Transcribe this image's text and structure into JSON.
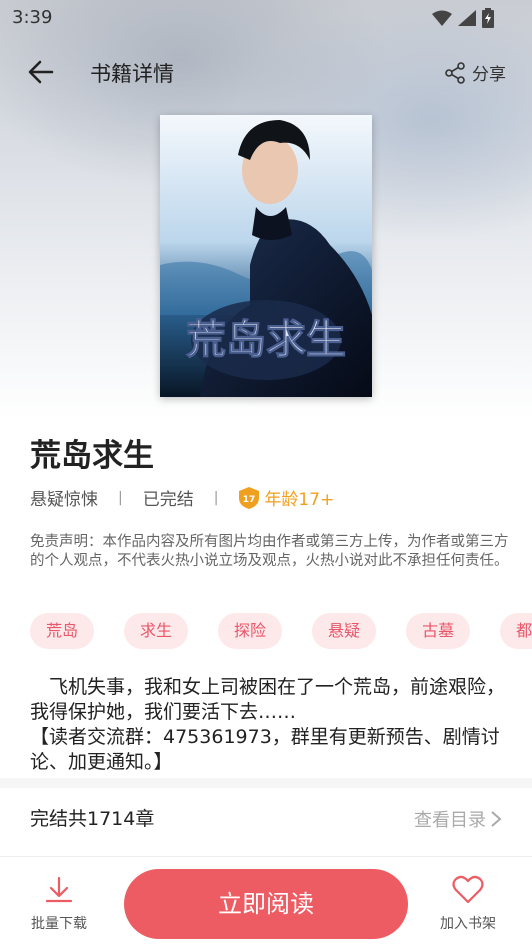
{
  "status_bar": {
    "time": "3:39"
  },
  "header": {
    "title": "书籍详情",
    "share_label": "分享"
  },
  "book": {
    "cover_title": "荒岛求生",
    "title": "荒岛求生",
    "genre": "悬疑惊悚",
    "status": "已完结",
    "age_icon_text": "17",
    "age_label": "年龄17+",
    "disclaimer": "免责声明：本作品内容及所有图片均由作者或第三方上传，为作者或第三方的个人观点，不代表火热小说立场及观点，火热小说对此不承担任何责任。",
    "tags": [
      "荒岛",
      "求生",
      "探险",
      "悬疑",
      "古墓",
      "都"
    ],
    "synopsis_line1": "　飞机失事，我和女上司被困在了一个荒岛，前途艰险，我得保护她，我们要活下去……",
    "synopsis_line2": "【读者交流群：475361973，群里有更新预告、剧情讨论、加更通知。】",
    "chapter_count": "完结共1714章",
    "toc_label": "查看目录"
  },
  "bottom_bar": {
    "download_label": "批量下载",
    "read_label": "立即阅读",
    "shelf_label": "加入书架"
  },
  "colors": {
    "accent": "#ee5c63",
    "tag_bg": "#fde8ea",
    "tag_text": "#e9576a",
    "age": "#f0a020"
  }
}
